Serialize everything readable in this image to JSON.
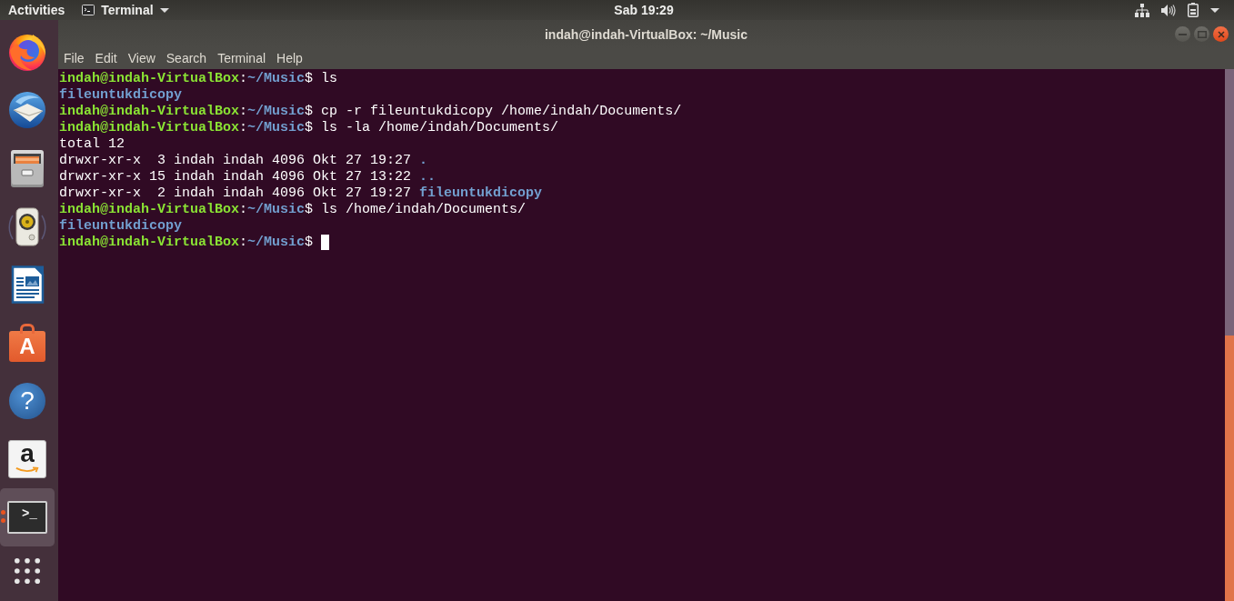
{
  "top_bar": {
    "activities": "Activities",
    "app_menu": "Terminal",
    "clock": "Sab 19:29"
  },
  "dock": {
    "items": [
      {
        "kind": "browser",
        "selected": false,
        "running": false
      },
      {
        "kind": "mail",
        "selected": false,
        "running": false
      },
      {
        "kind": "files",
        "selected": false,
        "running": false
      },
      {
        "kind": "music",
        "selected": false,
        "running": false
      },
      {
        "kind": "writer",
        "selected": false,
        "running": false
      },
      {
        "kind": "store",
        "glyph": "A",
        "selected": false,
        "running": false
      },
      {
        "kind": "help",
        "glyph": "?",
        "selected": false,
        "running": false
      },
      {
        "kind": "shop",
        "glyph": "a",
        "selected": false,
        "running": false
      },
      {
        "kind": "terminal",
        "glyph": ">_",
        "selected": true,
        "running": true
      }
    ]
  },
  "window": {
    "title": "indah@indah-VirtualBox: ~/Music",
    "menu": [
      "File",
      "Edit",
      "View",
      "Search",
      "Terminal",
      "Help"
    ]
  },
  "terminal": {
    "lines": [
      {
        "cursor": false,
        "segments": [
          {
            "text": "indah@indah-VirtualBox",
            "kind": "host"
          },
          {
            "text": ":",
            "kind": "plain"
          },
          {
            "text": "~/Music",
            "kind": "dir"
          },
          {
            "text": "$ ls",
            "kind": "plain"
          }
        ]
      },
      {
        "cursor": false,
        "segments": [
          {
            "text": "fileuntukdicopy",
            "kind": "dir"
          }
        ]
      },
      {
        "cursor": false,
        "segments": [
          {
            "text": "indah@indah-VirtualBox",
            "kind": "host"
          },
          {
            "text": ":",
            "kind": "plain"
          },
          {
            "text": "~/Music",
            "kind": "dir"
          },
          {
            "text": "$ cp -r fileuntukdicopy /home/indah/Documents/",
            "kind": "plain"
          }
        ]
      },
      {
        "cursor": false,
        "segments": [
          {
            "text": "indah@indah-VirtualBox",
            "kind": "host"
          },
          {
            "text": ":",
            "kind": "plain"
          },
          {
            "text": "~/Music",
            "kind": "dir"
          },
          {
            "text": "$ ls -la /home/indah/Documents/",
            "kind": "plain"
          }
        ]
      },
      {
        "cursor": false,
        "segments": [
          {
            "text": "total 12",
            "kind": "plain"
          }
        ]
      },
      {
        "cursor": false,
        "segments": [
          {
            "text": "drwxr-xr-x  3 indah indah 4096 Okt 27 19:27 ",
            "kind": "plain"
          },
          {
            "text": ".",
            "kind": "dir"
          }
        ]
      },
      {
        "cursor": false,
        "segments": [
          {
            "text": "drwxr-xr-x 15 indah indah 4096 Okt 27 13:22 ",
            "kind": "plain"
          },
          {
            "text": "..",
            "kind": "dir"
          }
        ]
      },
      {
        "cursor": false,
        "segments": [
          {
            "text": "drwxr-xr-x  2 indah indah 4096 Okt 27 19:27 ",
            "kind": "plain"
          },
          {
            "text": "fileuntukdicopy",
            "kind": "dir"
          }
        ]
      },
      {
        "cursor": false,
        "segments": [
          {
            "text": "indah@indah-VirtualBox",
            "kind": "host"
          },
          {
            "text": ":",
            "kind": "plain"
          },
          {
            "text": "~/Music",
            "kind": "dir"
          },
          {
            "text": "$ ls /home/indah/Documents/",
            "kind": "plain"
          }
        ]
      },
      {
        "cursor": false,
        "segments": [
          {
            "text": "fileuntukdicopy",
            "kind": "dir"
          }
        ]
      },
      {
        "cursor": true,
        "segments": [
          {
            "text": "indah@indah-VirtualBox",
            "kind": "host"
          },
          {
            "text": ":",
            "kind": "plain"
          },
          {
            "text": "~/Music",
            "kind": "dir"
          },
          {
            "text": "$ ",
            "kind": "plain"
          }
        ]
      }
    ]
  }
}
